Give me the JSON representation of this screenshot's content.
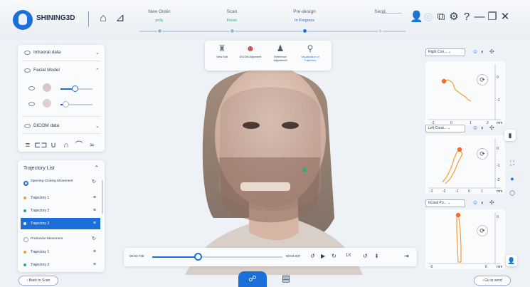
{
  "app": {
    "brand": "SHINING3D"
  },
  "steps": [
    {
      "label": "New Order",
      "status": "polly",
      "state": "done"
    },
    {
      "label": "Scan",
      "status": "Finish",
      "state": "done"
    },
    {
      "label": "Pre-design",
      "status": "In Progress",
      "state": "current"
    },
    {
      "label": "Send",
      "status": "",
      "state": "pending"
    }
  ],
  "window_icons": [
    "user-icon",
    "settings-ring-icon",
    "window-icon",
    "gear-icon",
    "help-icon",
    "minimize-icon",
    "restore-icon",
    "close-icon"
  ],
  "left": {
    "intraoral": "Intraoral data",
    "facial": "Facial Model",
    "facial_slider_1": 0.45,
    "facial_slider_2": 0.15,
    "dicom": "DICOM data",
    "tools": [
      "≡",
      "⊏⊐",
      "∪",
      "∩",
      "⌒",
      "≈"
    ]
  },
  "trajectory": {
    "title": "Trajectory List",
    "group1": "Opening-Closing Movement",
    "group2": "Protrusive Movement",
    "items": [
      {
        "label": "Trajectory 1",
        "color": "#f0a030",
        "selected": false
      },
      {
        "label": "Trajectory 2",
        "color": "#2bb07b",
        "selected": false
      },
      {
        "label": "Trajectory 3",
        "color": "#ffffff",
        "selected": true
      }
    ],
    "items2": [
      {
        "label": "Trajectory 1",
        "color": "#f0a030"
      },
      {
        "label": "Trajectory 2",
        "color": "#2bb07b"
      }
    ]
  },
  "viewtools": [
    {
      "label": "View Edit",
      "icon": "tooth-icon"
    },
    {
      "label": "DICOM Alignment",
      "icon": "face-icon"
    },
    {
      "label": "Reference Adjustment",
      "icon": "person-icon"
    },
    {
      "label": "Visualization of Trajectory",
      "icon": "trajectory-icon"
    }
  ],
  "graphs": [
    {
      "dropdown": "Right Con...",
      "x_ticks": [
        "-1",
        "0",
        "1",
        "2"
      ],
      "y_ticks": [
        "0",
        "-1"
      ],
      "unit": "mm"
    },
    {
      "dropdown": "Left Cond...",
      "x_ticks": [
        "-3",
        "-2",
        "-1",
        "0",
        "1"
      ],
      "y_ticks": [
        "0",
        "-1",
        "-2"
      ],
      "unit": "mm"
    },
    {
      "dropdown": "Incisal Po...",
      "x_ticks": [
        "-6",
        "6"
      ],
      "y_ticks": [
        "0"
      ],
      "unit": "mm"
    }
  ],
  "playback": {
    "start_time": "00:02:735",
    "end_time": "00:04:007",
    "progress": 0.35,
    "speed_label": "1X"
  },
  "bottom": {
    "back": "Back to Scan",
    "next": "Go to send"
  }
}
